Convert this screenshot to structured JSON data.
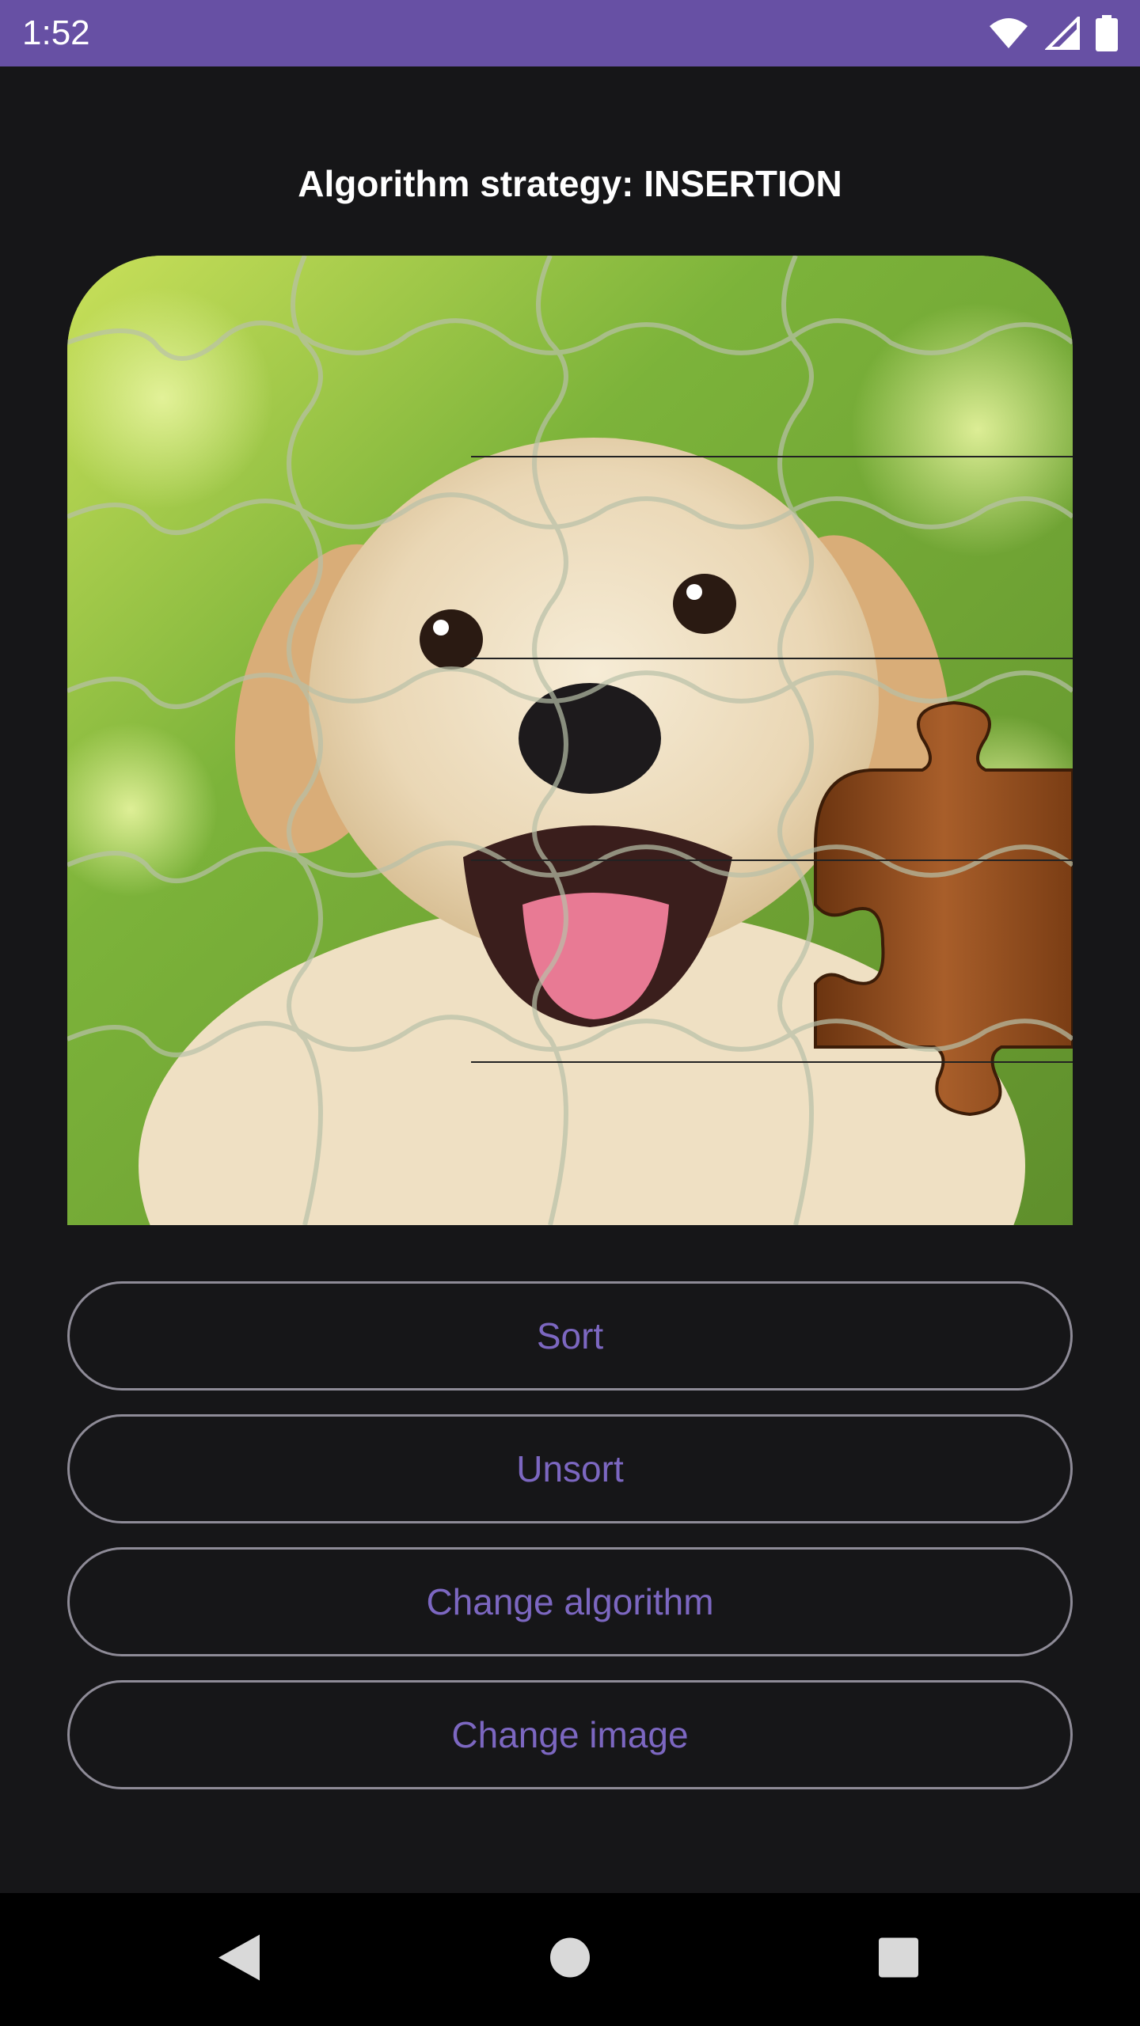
{
  "status_bar": {
    "time": "1:52",
    "icons": [
      "wifi-icon",
      "signal-icon",
      "battery-icon"
    ],
    "background": "#6750A4"
  },
  "title": "Algorithm strategy: INSERTION",
  "puzzle": {
    "image": "puppy-jigsaw-puzzle",
    "missing_piece_color": "#8a4a1c"
  },
  "buttons": {
    "sort": "Sort",
    "unsort": "Unsort",
    "change_algorithm": "Change algorithm",
    "change_image": "Change image"
  },
  "accent_color": "#7c67c1",
  "nav_bar": {
    "icons": [
      "back-icon",
      "home-icon",
      "recents-icon"
    ]
  }
}
